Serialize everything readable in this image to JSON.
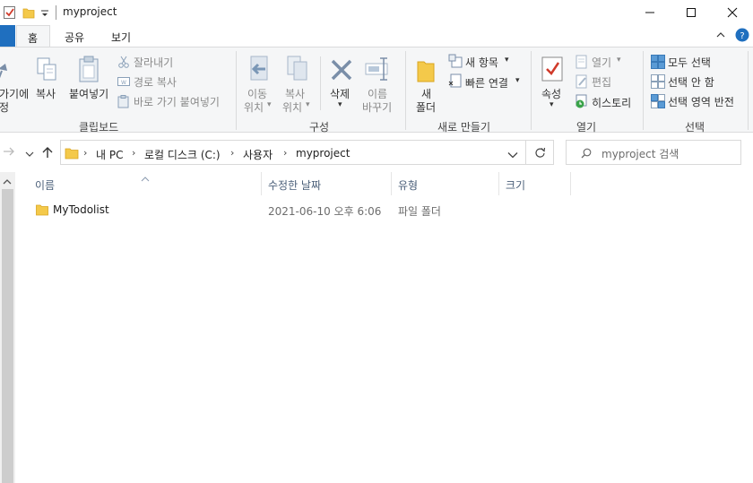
{
  "window": {
    "title": "myproject"
  },
  "tabs": [
    {
      "label": "홈"
    },
    {
      "label": "공유"
    },
    {
      "label": "보기"
    }
  ],
  "ribbon": {
    "clipboard": {
      "pin_label_1": "빠른 가기에",
      "pin_label_1_visible": "가기에",
      "pin_label_2": "고정",
      "pin_label_2_visible": "정",
      "copy": "복사",
      "paste": "붙여넣기",
      "cut": "잘라내기",
      "copy_path": "경로 복사",
      "paste_shortcut": "바로 가기 붙여넣기",
      "group_label": "클립보드"
    },
    "organize": {
      "move_to_1": "이동",
      "move_to_2": "위치",
      "copy_to_1": "복사",
      "copy_to_2": "위치",
      "delete": "삭제",
      "rename_1": "이름",
      "rename_2": "바꾸기",
      "group_label": "구성"
    },
    "new": {
      "new_folder_1": "새",
      "new_folder_2": "폴더",
      "new_item": "새 항목",
      "easy_access": "빠른 연결",
      "group_label": "새로 만들기"
    },
    "open": {
      "properties": "속성",
      "open": "열기",
      "edit": "편집",
      "history": "히스토리",
      "group_label": "열기"
    },
    "select": {
      "select_all": "모두 선택",
      "select_none": "선택 안 함",
      "invert": "선택 영역 반전",
      "group_label": "선택"
    }
  },
  "address": {
    "crumbs": [
      "내 PC",
      "로컬 디스크 (C:)",
      "사용자",
      "myproject"
    ],
    "search_placeholder": "myproject 검색"
  },
  "columns": {
    "name": "이름",
    "modified": "수정한 날짜",
    "type": "유형",
    "size": "크기"
  },
  "files": [
    {
      "name": "MyTodolist",
      "modified": "2021-06-10 오후 6:06",
      "type": "파일 폴더",
      "size": ""
    }
  ],
  "colors": {
    "accent": "#1f6fbf",
    "folder": "#f4c94a",
    "header_text": "#4c607a"
  }
}
